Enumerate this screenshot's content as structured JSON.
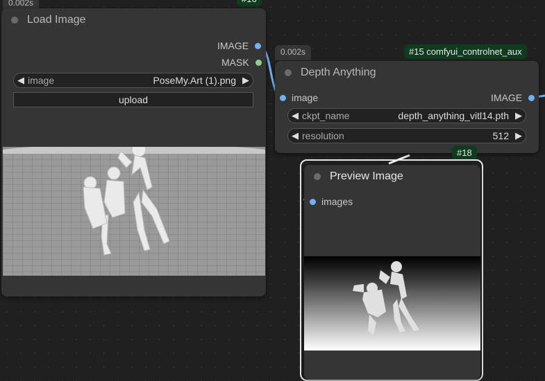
{
  "load_node": {
    "timing": "0.002s",
    "badge_partial": "#16",
    "title": "Load Image",
    "outputs": [
      "IMAGE",
      "MASK"
    ],
    "image_widget_label": "image",
    "image_widget_value": "PoseMy.Art (1).png",
    "upload_label": "upload"
  },
  "depth_node": {
    "timing": "0.002s",
    "badge": "#15 comfyui_controlnet_aux",
    "title": "Depth Anything",
    "input": "image",
    "output": "IMAGE",
    "ckpt_label": "ckpt_name",
    "ckpt_value": "depth_anything_vitl14.pth",
    "res_label": "resolution",
    "res_value": "512"
  },
  "preview_node": {
    "badge": "#18",
    "title": "Preview Image",
    "input": "images"
  },
  "colors": {
    "link_blue": "#6fb1f2",
    "mask_green": "#8fcf8f",
    "badge_bg": "#0f3b1f"
  }
}
